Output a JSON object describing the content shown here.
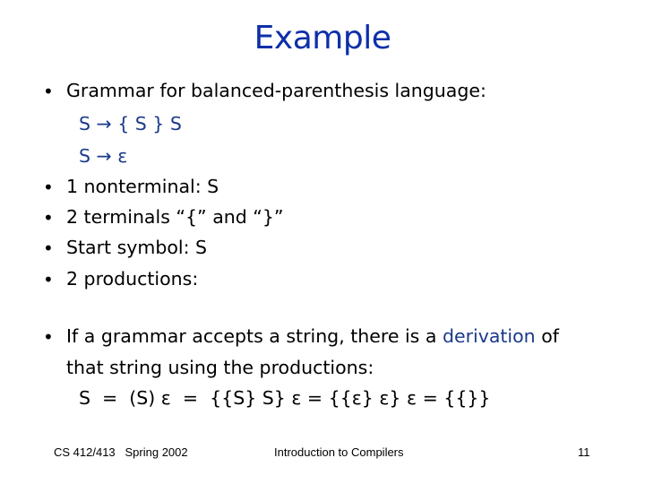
{
  "slide": {
    "title": "Example",
    "bullets_group1": [
      {
        "text": "Grammar for balanced-parenthesis language:"
      },
      {
        "text": "1 nonterminal: S"
      },
      {
        "text": "2 terminals “{” and “}”"
      },
      {
        "text": "Start symbol: S"
      },
      {
        "text": "2 productions:"
      }
    ],
    "productions": [
      "S →  { S } S",
      "S →  ε"
    ],
    "bullet2": {
      "line1_pre": "If a grammar accepts a string, there is a ",
      "line1_highlight": "derivation",
      "line1_post": " of",
      "line2": "that string using the productions:",
      "line3": "S  =  (S) ε  =  {{S} S} ε = {{ε} ε} ε = {{}}"
    },
    "colors": {
      "title": "#0d2fa8",
      "highlight": "#1a3a8a"
    }
  },
  "footer": {
    "course": "CS 412/413   Spring 2002",
    "subject": "Introduction to Compilers",
    "page_number": "11"
  }
}
